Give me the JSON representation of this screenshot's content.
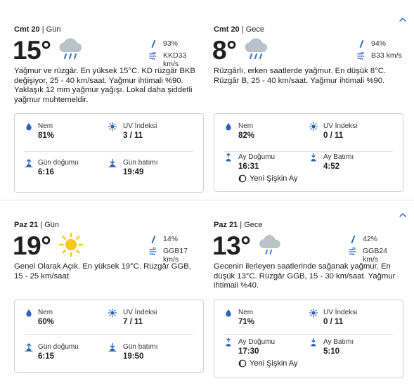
{
  "days": [
    {
      "day_panel": {
        "label": "Cmt 20",
        "sep": " | ",
        "sub": "Gün",
        "temp": "15°",
        "icon": "rain-cloud-icon",
        "precip": "93%",
        "wind": "KKD33 km/s",
        "desc": "Yağmur ve rüzgâr. En yüksek 15°C. KD rüzgâr BKB değişiyor, 25 - 40 km/saat. Yağmur ihtimali %90. Yaklaşık 12 mm yağmur yağışı. Lokal daha şiddetli yağmur muhtemeldir.",
        "humidity_label": "Nem",
        "humidity": "81%",
        "uv_label": "UV İndeksi",
        "uv": "3 / 11",
        "rise_label": "Gün doğumu",
        "rise": "6:16",
        "set_label": "Gün batımı",
        "set": "19:49"
      },
      "night_panel": {
        "label": "Cmt 20",
        "sep": " | ",
        "sub": "Gece",
        "temp": "8°",
        "icon": "rain-cloud-icon",
        "precip": "94%",
        "wind": "B33 km/s",
        "desc": "Rüzgârlı, erken saatlerde yağmur. En düşük 8°C. Rüzgâr B, 25 - 40 km/saat. Yağmur ihtimali %90.",
        "humidity_label": "Nem",
        "humidity": "82%",
        "uv_label": "UV İndeksi",
        "uv": "0 / 11",
        "rise_label": "Ay Doğumu",
        "rise": "16:31",
        "set_label": "Ay Batımı",
        "set": "4:52",
        "moon_phase": "Yeni Şişkin Ay"
      }
    },
    {
      "day_panel": {
        "label": "Paz 21",
        "sep": " | ",
        "sub": "Gün",
        "temp": "19°",
        "icon": "sun-icon",
        "precip": "14%",
        "wind": "GGB17 km/s",
        "desc": "Genel Olarak Açık. En yüksek 19°C. Rüzgâr GGB, 15 - 25 km/saat.",
        "humidity_label": "Nem",
        "humidity": "60%",
        "uv_label": "UV İndeksi",
        "uv": "7 / 11",
        "rise_label": "Gün doğumu",
        "rise": "6:15",
        "set_label": "Gün batımı",
        "set": "19:50"
      },
      "night_panel": {
        "label": "Paz 21",
        "sep": " | ",
        "sub": "Gece",
        "temp": "13°",
        "icon": "night-showers-icon",
        "precip": "42%",
        "wind": "GGB24 km/s",
        "desc": "Gecenin ilerleyen saatlerinde sağanak yağmur. En düşük 13°C. Rüzgâr GGB, 15 - 30 km/saat. Yağmur ihtimali %40.",
        "humidity_label": "Nem",
        "humidity": "71%",
        "uv_label": "UV İndeksi",
        "uv": "0 / 11",
        "rise_label": "Ay Doğumu",
        "rise": "17:30",
        "set_label": "Ay Batımı",
        "set": "5:10",
        "moon_phase": "Yeni Şişkin Ay"
      }
    }
  ],
  "colors": {
    "accent": "#1f5fbf",
    "icon_blue": "#2a62b4",
    "cloud": "#b9c1c9",
    "sun": "#f7c817"
  }
}
